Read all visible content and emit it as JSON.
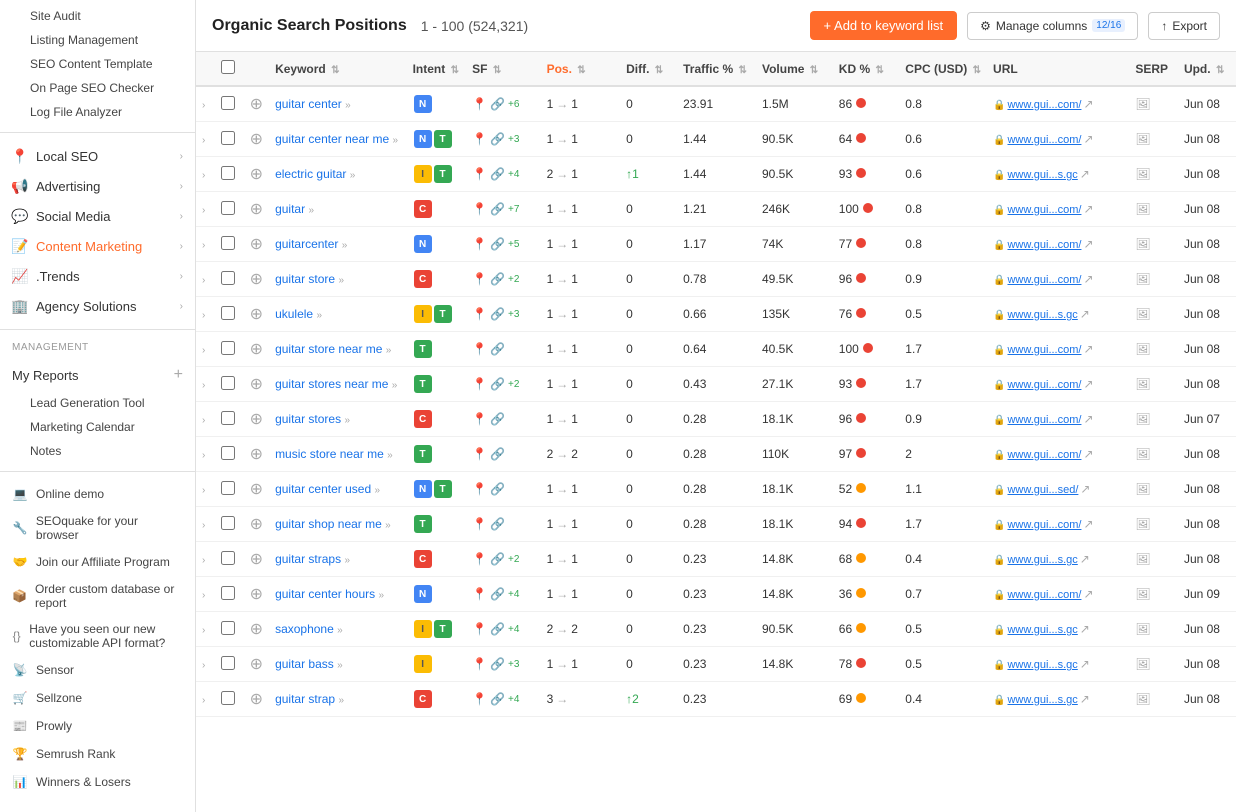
{
  "sidebar": {
    "top_items": [
      {
        "id": "site-audit",
        "label": "Site Audit",
        "icon": "🔍",
        "has_arrow": false
      },
      {
        "id": "listing-management",
        "label": "Listing Management",
        "icon": "📋",
        "has_arrow": false
      },
      {
        "id": "seo-content-template",
        "label": "SEO Content Template",
        "icon": "📄",
        "has_arrow": false
      },
      {
        "id": "on-page-seo-checker",
        "label": "On Page SEO Checker",
        "icon": "✅",
        "has_arrow": false
      },
      {
        "id": "log-file-analyzer",
        "label": "Log File Analyzer",
        "icon": "📊",
        "has_arrow": false
      }
    ],
    "nav_items": [
      {
        "id": "local-seo",
        "label": "Local SEO",
        "has_arrow": true
      },
      {
        "id": "advertising",
        "label": "Advertising",
        "has_arrow": true
      },
      {
        "id": "social-media",
        "label": "Social Media",
        "has_arrow": true
      },
      {
        "id": "content-marketing",
        "label": "Content Marketing",
        "has_arrow": true,
        "active": true
      },
      {
        "id": "trends",
        "label": ".Trends",
        "has_arrow": true
      },
      {
        "id": "agency-solutions",
        "label": "Agency Solutions",
        "has_arrow": true
      }
    ],
    "management_label": "MANAGEMENT",
    "management_items": [
      {
        "id": "my-reports",
        "label": "My Reports",
        "has_add": true
      },
      {
        "id": "lead-generation",
        "label": "Lead Generation Tool"
      },
      {
        "id": "marketing-calendar",
        "label": "Marketing Calendar"
      },
      {
        "id": "notes",
        "label": "Notes"
      }
    ],
    "footer_items": [
      {
        "id": "online-demo",
        "label": "Online demo",
        "icon": "💻"
      },
      {
        "id": "seoquake",
        "label": "SEOquake for your browser",
        "icon": "🔧"
      },
      {
        "id": "affiliate",
        "label": "Join our Affiliate Program",
        "icon": "🤝"
      },
      {
        "id": "order-db",
        "label": "Order custom database or report",
        "icon": "📦"
      },
      {
        "id": "api-format",
        "label": "Have you seen our new customizable API format?",
        "icon": "{}"
      },
      {
        "id": "sensor",
        "label": "Sensor",
        "icon": "📡"
      },
      {
        "id": "sellzone",
        "label": "Sellzone",
        "icon": "🛒"
      },
      {
        "id": "prowly",
        "label": "Prowly",
        "icon": "📰"
      },
      {
        "id": "semrush-rank",
        "label": "Semrush Rank",
        "icon": "🏆"
      },
      {
        "id": "winners-losers",
        "label": "Winners & Losers",
        "icon": "📈"
      }
    ]
  },
  "header": {
    "title": "Organic Search Positions",
    "range": "1 - 100 (524,321)",
    "btn_add_label": "+ Add to keyword list",
    "btn_manage_label": "Manage columns",
    "manage_count": "12/16",
    "btn_export_label": "Export"
  },
  "table": {
    "columns": [
      {
        "id": "keyword",
        "label": "Keyword"
      },
      {
        "id": "intent",
        "label": "Intent"
      },
      {
        "id": "sf",
        "label": "SF"
      },
      {
        "id": "pos",
        "label": "Pos."
      },
      {
        "id": "diff",
        "label": "Diff."
      },
      {
        "id": "traffic",
        "label": "Traffic %"
      },
      {
        "id": "volume",
        "label": "Volume"
      },
      {
        "id": "kd",
        "label": "KD %"
      },
      {
        "id": "cpc",
        "label": "CPC (USD)"
      },
      {
        "id": "url",
        "label": "URL"
      },
      {
        "id": "serp",
        "label": "SERP"
      },
      {
        "id": "upd",
        "label": "Upd."
      }
    ],
    "rows": [
      {
        "keyword": "guitar center",
        "kw_arrows": "»",
        "intents": [
          "N"
        ],
        "sf_count": "+6",
        "pos_from": "1",
        "pos_to": "1",
        "diff": "0",
        "traffic": "23.91",
        "volume": "1.5M",
        "kd": "86",
        "kd_color": "red",
        "cpc": "0.8",
        "url": "www.gui...com/",
        "url_lock": true,
        "upd": "Jun 08"
      },
      {
        "keyword": "guitar center near me",
        "kw_arrows": "»",
        "intents": [
          "N",
          "T"
        ],
        "sf_count": "+3",
        "pos_from": "1",
        "pos_to": "1",
        "diff": "0",
        "traffic": "1.44",
        "volume": "90.5K",
        "kd": "64",
        "kd_color": "red",
        "cpc": "0.6",
        "url": "www.gui...com/",
        "url_lock": true,
        "upd": "Jun 08"
      },
      {
        "keyword": "electric guitar",
        "kw_arrows": "»",
        "intents": [
          "I",
          "T"
        ],
        "sf_count": "+4",
        "pos_from": "2",
        "pos_to": "1",
        "diff": "↑1",
        "diff_up": true,
        "traffic": "1.44",
        "volume": "90.5K",
        "kd": "93",
        "kd_color": "red",
        "cpc": "0.6",
        "url": "www.gui...s.gc",
        "url_lock": true,
        "upd": "Jun 08"
      },
      {
        "keyword": "guitar",
        "kw_arrows": "»",
        "intents": [
          "C"
        ],
        "sf_count": "+7",
        "pos_from": "1",
        "pos_to": "1",
        "diff": "0",
        "traffic": "1.21",
        "volume": "246K",
        "kd": "100",
        "kd_color": "red",
        "cpc": "0.8",
        "url": "www.gui...com/",
        "url_lock": true,
        "upd": "Jun 08"
      },
      {
        "keyword": "guitarcenter",
        "kw_arrows": "»",
        "intents": [
          "N"
        ],
        "sf_count": "+5",
        "pos_from": "1",
        "pos_to": "1",
        "diff": "0",
        "traffic": "1.17",
        "volume": "74K",
        "kd": "77",
        "kd_color": "red",
        "cpc": "0.8",
        "url": "www.gui...com/",
        "url_lock": true,
        "upd": "Jun 08"
      },
      {
        "keyword": "guitar store",
        "kw_arrows": "»",
        "intents": [
          "C"
        ],
        "sf_count": "+2",
        "pos_from": "1",
        "pos_to": "1",
        "diff": "0",
        "traffic": "0.78",
        "volume": "49.5K",
        "kd": "96",
        "kd_color": "red",
        "cpc": "0.9",
        "url": "www.gui...com/",
        "url_lock": true,
        "upd": "Jun 08"
      },
      {
        "keyword": "ukulele",
        "kw_arrows": "»",
        "intents": [
          "I",
          "T"
        ],
        "sf_count": "+3",
        "pos_from": "1",
        "pos_to": "1",
        "diff": "0",
        "traffic": "0.66",
        "volume": "135K",
        "kd": "76",
        "kd_color": "red",
        "cpc": "0.5",
        "url": "www.gui...s.gc",
        "url_lock": true,
        "upd": "Jun 08"
      },
      {
        "keyword": "guitar store near me",
        "kw_arrows": "»",
        "intents": [
          "T"
        ],
        "sf_count": "",
        "pos_from": "1",
        "pos_to": "1",
        "diff": "0",
        "traffic": "0.64",
        "volume": "40.5K",
        "kd": "100",
        "kd_color": "red",
        "cpc": "1.7",
        "url": "www.gui...com/",
        "url_lock": true,
        "upd": "Jun 08"
      },
      {
        "keyword": "guitar stores near me",
        "kw_arrows": "»",
        "intents": [
          "T"
        ],
        "sf_count": "+2",
        "pos_from": "1",
        "pos_to": "1",
        "diff": "0",
        "traffic": "0.43",
        "volume": "27.1K",
        "kd": "93",
        "kd_color": "red",
        "cpc": "1.7",
        "url": "www.gui...com/",
        "url_lock": true,
        "upd": "Jun 08"
      },
      {
        "keyword": "guitar stores",
        "kw_arrows": "»",
        "intents": [
          "C"
        ],
        "sf_count": "",
        "pos_from": "1",
        "pos_to": "1",
        "diff": "0",
        "traffic": "0.28",
        "volume": "18.1K",
        "kd": "96",
        "kd_color": "red",
        "cpc": "0.9",
        "url": "www.gui...com/",
        "url_lock": true,
        "upd": "Jun 07"
      },
      {
        "keyword": "music store near me",
        "kw_arrows": "»",
        "intents": [
          "T"
        ],
        "sf_count": "",
        "pos_from": "2",
        "pos_to": "2",
        "diff": "0",
        "traffic": "0.28",
        "volume": "110K",
        "kd": "97",
        "kd_color": "red",
        "cpc": "2",
        "url": "www.gui...com/",
        "url_lock": true,
        "upd": "Jun 08"
      },
      {
        "keyword": "guitar center used",
        "kw_arrows": "»",
        "intents": [
          "N",
          "T"
        ],
        "sf_count": "",
        "pos_from": "1",
        "pos_to": "1",
        "diff": "0",
        "traffic": "0.28",
        "volume": "18.1K",
        "kd": "52",
        "kd_color": "orange",
        "cpc": "1.1",
        "url": "www.gui...sed/",
        "url_lock": true,
        "upd": "Jun 08"
      },
      {
        "keyword": "guitar shop near me",
        "kw_arrows": "»",
        "intents": [
          "T"
        ],
        "sf_count": "",
        "pos_from": "1",
        "pos_to": "1",
        "diff": "0",
        "traffic": "0.28",
        "volume": "18.1K",
        "kd": "94",
        "kd_color": "red",
        "cpc": "1.7",
        "url": "www.gui...com/",
        "url_lock": true,
        "upd": "Jun 08"
      },
      {
        "keyword": "guitar straps",
        "kw_arrows": "»",
        "intents": [
          "C"
        ],
        "sf_count": "+2",
        "pos_from": "1",
        "pos_to": "1",
        "diff": "0",
        "traffic": "0.23",
        "volume": "14.8K",
        "kd": "68",
        "kd_color": "orange",
        "cpc": "0.4",
        "url": "www.gui...s.gc",
        "url_lock": true,
        "upd": "Jun 08"
      },
      {
        "keyword": "guitar center hours",
        "kw_arrows": "»",
        "intents": [
          "N"
        ],
        "sf_count": "+4",
        "pos_from": "1",
        "pos_to": "1",
        "diff": "0",
        "traffic": "0.23",
        "volume": "14.8K",
        "kd": "36",
        "kd_color": "orange",
        "cpc": "0.7",
        "url": "www.gui...com/",
        "url_lock": true,
        "upd": "Jun 09"
      },
      {
        "keyword": "saxophone",
        "kw_arrows": "»",
        "intents": [
          "I",
          "T"
        ],
        "sf_count": "+4",
        "pos_from": "2",
        "pos_to": "2",
        "diff": "0",
        "traffic": "0.23",
        "volume": "90.5K",
        "kd": "66",
        "kd_color": "orange",
        "cpc": "0.5",
        "url": "www.gui...s.gc",
        "url_lock": true,
        "upd": "Jun 08"
      },
      {
        "keyword": "guitar bass",
        "kw_arrows": "»",
        "intents": [
          "I"
        ],
        "sf_count": "+3",
        "pos_from": "1",
        "pos_to": "1",
        "diff": "0",
        "traffic": "0.23",
        "volume": "14.8K",
        "kd": "78",
        "kd_color": "red",
        "cpc": "0.5",
        "url": "www.gui...s.gc",
        "url_lock": true,
        "upd": "Jun 08"
      },
      {
        "keyword": "guitar strap",
        "kw_arrows": "»",
        "intents": [
          "C"
        ],
        "sf_count": "+4",
        "pos_from": "3",
        "pos_to": "",
        "diff": "↑2",
        "diff_up": true,
        "traffic": "0.23",
        "volume": "",
        "kd": "69",
        "kd_color": "orange",
        "cpc": "0.4",
        "url": "www.gui...s.gc",
        "url_lock": true,
        "upd": "Jun 08"
      }
    ]
  }
}
